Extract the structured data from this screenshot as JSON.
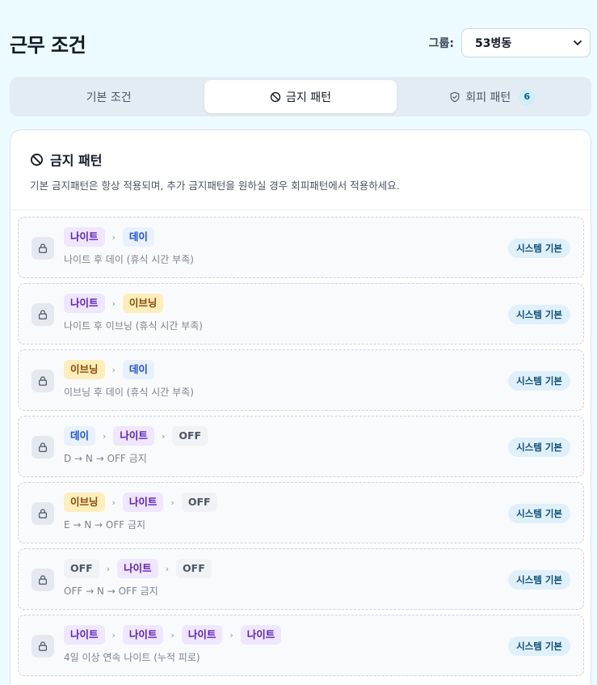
{
  "page": {
    "title": "근무 조건"
  },
  "group": {
    "label": "그룹:",
    "value": "53병동"
  },
  "tabs": [
    {
      "label": "기본 조건",
      "icon": "none",
      "active": false
    },
    {
      "label": "금지 패턴",
      "icon": "ban-icon",
      "active": true
    },
    {
      "label": "회피 패턴",
      "icon": "shield-check-icon",
      "badge": "6",
      "active": false
    }
  ],
  "panel": {
    "title": "금지 패턴",
    "description": "기본 금지패턴은 항상 적용되며, 추가 금지패턴을 원하실 경우 회피패턴에서 적용하세요."
  },
  "separator": "›",
  "rules": [
    {
      "chips": [
        {
          "label": "나이트",
          "kind": "night"
        },
        {
          "label": "데이",
          "kind": "day"
        }
      ],
      "description": "나이트 후 데이 (휴식 시간 부족)",
      "badge": "시스템 기본"
    },
    {
      "chips": [
        {
          "label": "나이트",
          "kind": "night"
        },
        {
          "label": "이브닝",
          "kind": "evening"
        }
      ],
      "description": "나이트 후 이브닝 (휴식 시간 부족)",
      "badge": "시스템 기본"
    },
    {
      "chips": [
        {
          "label": "이브닝",
          "kind": "evening"
        },
        {
          "label": "데이",
          "kind": "day"
        }
      ],
      "description": "이브닝 후 데이 (휴식 시간 부족)",
      "badge": "시스템 기본"
    },
    {
      "chips": [
        {
          "label": "데이",
          "kind": "day"
        },
        {
          "label": "나이트",
          "kind": "night"
        },
        {
          "label": "OFF",
          "kind": "off"
        }
      ],
      "description": "D → N → OFF 금지",
      "badge": "시스템 기본"
    },
    {
      "chips": [
        {
          "label": "이브닝",
          "kind": "evening"
        },
        {
          "label": "나이트",
          "kind": "night"
        },
        {
          "label": "OFF",
          "kind": "off"
        }
      ],
      "description": "E → N → OFF 금지",
      "badge": "시스템 기본"
    },
    {
      "chips": [
        {
          "label": "OFF",
          "kind": "off"
        },
        {
          "label": "나이트",
          "kind": "night"
        },
        {
          "label": "OFF",
          "kind": "off"
        }
      ],
      "description": "OFF → N → OFF 금지",
      "badge": "시스템 기본"
    },
    {
      "chips": [
        {
          "label": "나이트",
          "kind": "night"
        },
        {
          "label": "나이트",
          "kind": "night"
        },
        {
          "label": "나이트",
          "kind": "night"
        },
        {
          "label": "나이트",
          "kind": "night"
        }
      ],
      "description": "4일 이상 연속 나이트 (누적 피로)",
      "badge": "시스템 기본"
    }
  ]
}
